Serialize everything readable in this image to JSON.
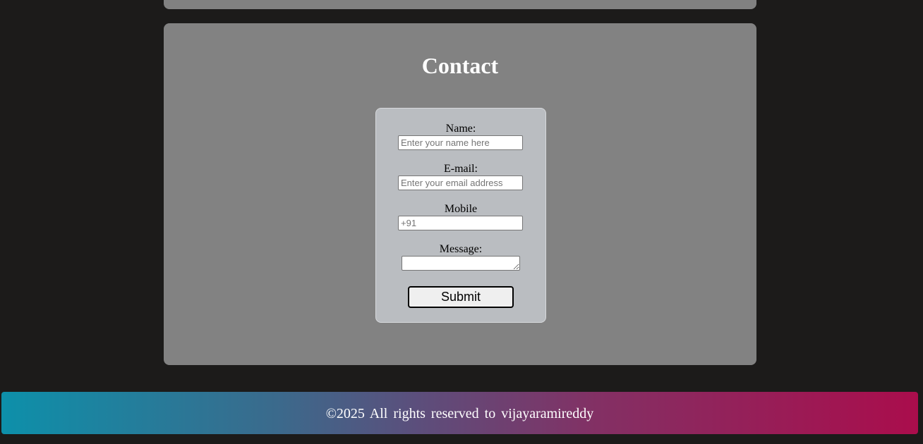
{
  "contact": {
    "title": "Contact",
    "form": {
      "name_label": "Name:",
      "name_placeholder": "Enter your name here",
      "email_label": "E-mail:",
      "email_placeholder": "Enter your email address",
      "mobile_label": "Mobile",
      "mobile_placeholder": "+91",
      "message_label": "Message:",
      "submit_label": "Submit"
    }
  },
  "footer": {
    "text": "©2025 All rights reserved to vijayaramireddy"
  },
  "colors": {
    "page_background": "#1c1b1a",
    "section_background": "#828282",
    "form_background": "#babdc1",
    "footer_gradient_start": "#0d90aa",
    "footer_gradient_end": "#aa0d4c"
  }
}
